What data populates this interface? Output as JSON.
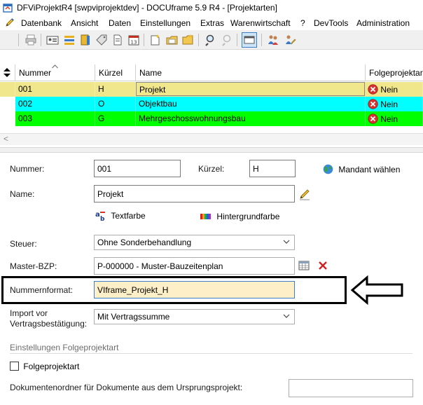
{
  "window": {
    "title": "DFViProjektR4 [swpviprojektdev] - DOCUframe 5.9 R4 - [Projektarten]"
  },
  "menu": {
    "items": [
      "Datenbank",
      "Ansicht",
      "Daten",
      "Einstellungen",
      "Extras",
      "Warenwirtschaft",
      "?",
      "DevTools",
      "Administration"
    ]
  },
  "toolbar": {
    "icons": [
      "print-icon",
      "contact-card-icon",
      "list-icon",
      "book-icon",
      "tag-icon",
      "document-icon",
      "calendar-icon",
      "new-page-icon",
      "new-folder-icon",
      "folder-open-icon",
      "search-icon",
      "search-disabled-icon",
      "view-toggle-icon",
      "users-icon",
      "user-edit-icon"
    ]
  },
  "grid": {
    "columns": [
      "Nummer",
      "Kürzel",
      "Name",
      "Folgeprojektar"
    ],
    "rows": [
      {
        "nummer": "001",
        "kuerzel": "H",
        "name": "Projekt",
        "folge": "Nein",
        "color": "#f0e68c"
      },
      {
        "nummer": "002",
        "kuerzel": "O",
        "name": "Objektbau",
        "folge": "Nein",
        "color": "#00ffff"
      },
      {
        "nummer": "003",
        "kuerzel": "G",
        "name": "Mehrgeschosswohnungsbau",
        "folge": "Nein",
        "color": "#00ff00"
      }
    ],
    "scroll_left": "<"
  },
  "form": {
    "nummer_label": "Nummer:",
    "nummer_value": "001",
    "kuerzel_label": "Kürzel:",
    "kuerzel_value": "H",
    "mandant_label": "Mandant wählen",
    "name_label": "Name:",
    "name_value": "Projekt",
    "textfarbe_label": "Textfarbe",
    "hintergrund_label": "Hintergrundfarbe",
    "steuer_label": "Steuer:",
    "steuer_value": "Ohne Sonderbehandlung",
    "master_label": "Master-BZP:",
    "master_value": "P-000000 - Muster-Bauzeitenplan",
    "nummernformat_label": "Nummernformat:",
    "nummernformat_value": "VIframe_Projekt_H",
    "import_label_1": "Import vor",
    "import_label_2": "Vertragsbestätigung:",
    "import_value": "Mit Vertragssumme",
    "section_title": "Einstellungen Folgeprojektart",
    "folge_checkbox_label": "Folgeprojektart",
    "folge_checked": false,
    "dokordner_label": "Dokumentenordner für Dokumente aus dem Ursprungsprojekt:",
    "dokordner_value": ""
  },
  "colors": {
    "highlight_input": "#fdf0c8",
    "nein_icon": "#d93030"
  }
}
